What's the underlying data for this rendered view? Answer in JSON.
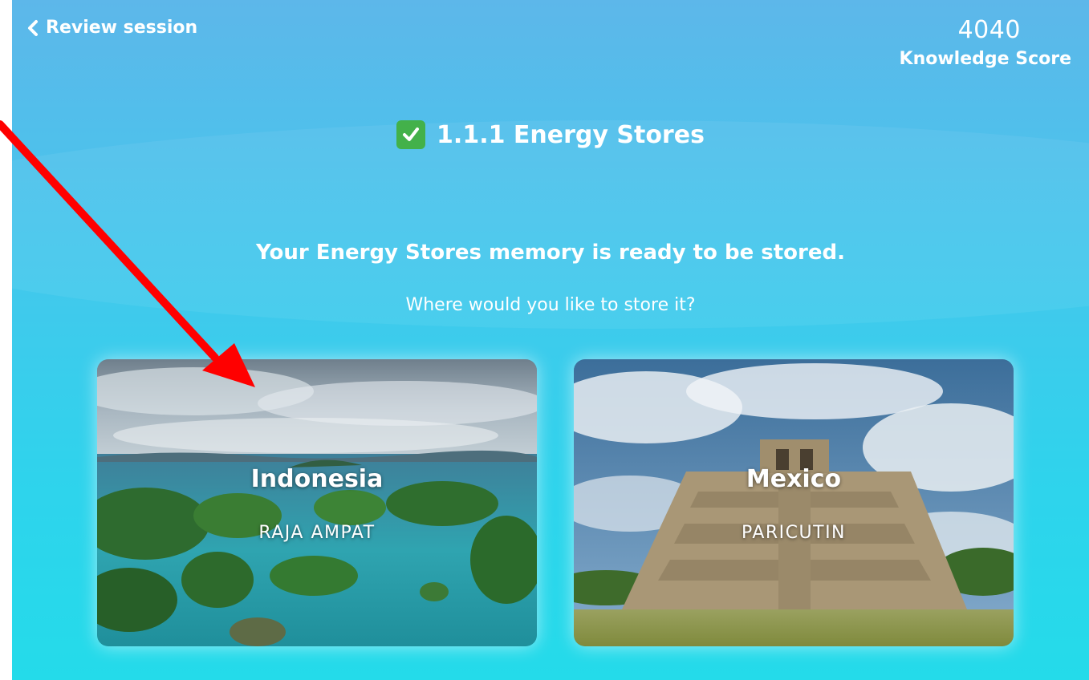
{
  "header": {
    "back_label": "Review session",
    "score_value": "4040",
    "score_label": "Knowledge Score"
  },
  "topic": {
    "title": "1.1.1 Energy Stores",
    "status_icon": "check-mark-button-icon"
  },
  "prompt": {
    "headline": "Your Energy Stores memory is ready to be stored.",
    "question": "Where would you like to store it?"
  },
  "destinations": [
    {
      "country": "Indonesia",
      "place": "RAJA AMPAT",
      "image": "tropical-islands-lagoon"
    },
    {
      "country": "Mexico",
      "place": "PARICUTIN",
      "image": "step-pyramid-under-clouds"
    }
  ],
  "annotation": {
    "type": "arrow",
    "color": "#ff0000"
  },
  "colors": {
    "accent_green": "#43b14a",
    "background_top": "#5db7ea",
    "background_bottom": "#24dbea"
  }
}
